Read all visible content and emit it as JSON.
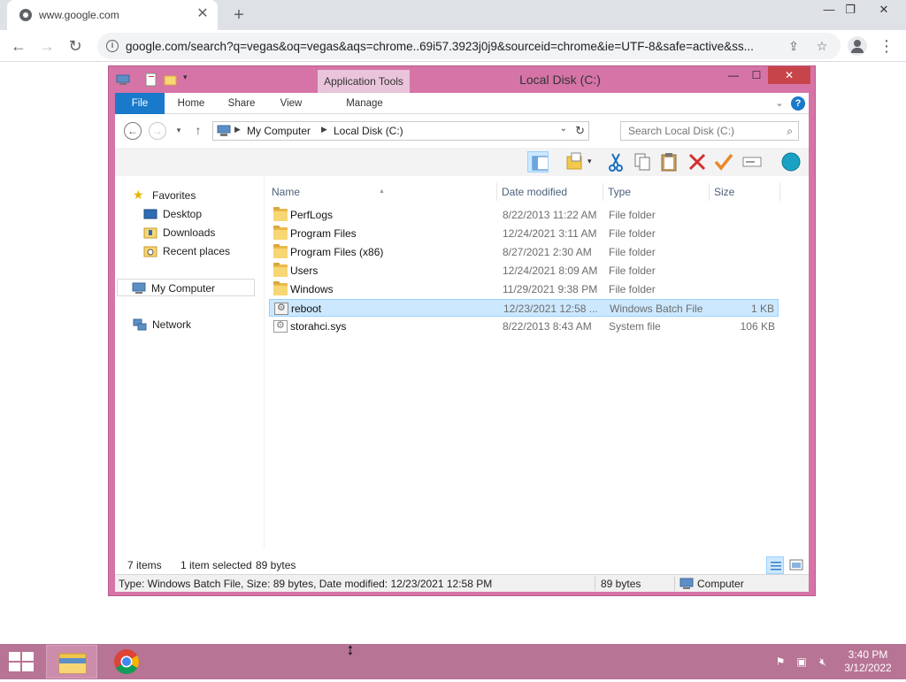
{
  "browser": {
    "tab_title": "www.google.com",
    "tab_close": "✕",
    "new_tab": "+",
    "url": "google.com/search?q=vegas&oq=vegas&aqs=chrome..69i57.3923j0j9&sourceid=chrome&ie=UTF-8&safe=active&ss...",
    "controls": {
      "minimize": "—",
      "restore": "❐",
      "close": "✕"
    },
    "nav": {
      "back": "←",
      "forward": "→",
      "reload": "↻",
      "share": "⇪",
      "bookmark": "☆",
      "menu": "⋮"
    }
  },
  "explorer": {
    "window_title": "Local Disk (C:)",
    "contextual_tab": "Application Tools",
    "controls": {
      "minimize": "—",
      "maximize": "☐",
      "close": "✕"
    },
    "ribbon_tabs": [
      "File",
      "Home",
      "Share",
      "View",
      "Manage"
    ],
    "ribbon_expand": "⌄",
    "help": "?",
    "breadcrumb": [
      "My Computer",
      "Local Disk (C:)"
    ],
    "search_placeholder": "Search Local Disk (C:)",
    "nav_pane": {
      "favorites": "Favorites",
      "favorite_items": [
        "Desktop",
        "Downloads",
        "Recent places"
      ],
      "my_computer": "My Computer",
      "network": "Network"
    },
    "columns": {
      "name": "Name",
      "date": "Date modified",
      "type": "Type",
      "size": "Size"
    },
    "files": [
      {
        "name": "PerfLogs",
        "date": "8/22/2013 11:22 AM",
        "type": "File folder",
        "size": "",
        "kind": "folder"
      },
      {
        "name": "Program Files",
        "date": "12/24/2021 3:11 AM",
        "type": "File folder",
        "size": "",
        "kind": "folder"
      },
      {
        "name": "Program Files (x86)",
        "date": "8/27/2021 2:30 AM",
        "type": "File folder",
        "size": "",
        "kind": "folder"
      },
      {
        "name": "Users",
        "date": "12/24/2021 8:09 AM",
        "type": "File folder",
        "size": "",
        "kind": "folder"
      },
      {
        "name": "Windows",
        "date": "11/29/2021 9:38 PM",
        "type": "File folder",
        "size": "",
        "kind": "folder"
      },
      {
        "name": "reboot",
        "date": "12/23/2021 12:58 ...",
        "type": "Windows Batch File",
        "size": "1 KB",
        "kind": "batch"
      },
      {
        "name": "storahci.sys",
        "date": "8/22/2013 8:43 AM",
        "type": "System file",
        "size": "106 KB",
        "kind": "sys"
      }
    ],
    "status": {
      "items": "7 items",
      "selected": "1 item selected",
      "bytes": "89 bytes"
    },
    "details": {
      "info": "Type: Windows Batch File, Size: 89 bytes, Date modified: 12/23/2021 12:58 PM",
      "size": "89 bytes",
      "location": "Computer"
    }
  },
  "taskbar": {
    "time": "3:40 PM",
    "date": "3/12/2022"
  },
  "colors": {
    "window_frame": "#d674a7",
    "taskbar": "#b77495",
    "ribbon_file_tab": "#1979ca",
    "selection": "#cce8ff",
    "close_button": "#c7454a"
  }
}
